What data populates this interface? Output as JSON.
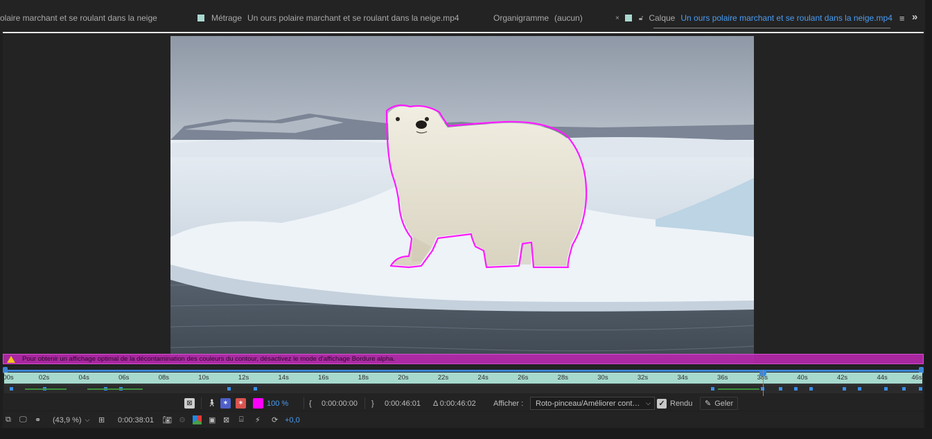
{
  "tabs": {
    "tab1_label": "olaire marchant et se roulant dans la neige",
    "tab2_prefix": "Métrage",
    "tab2_label": "Un ours polaire marchant et se roulant dans la neige.mp4",
    "tab3_prefix": "Organigramme",
    "tab3_label": "(aucun)",
    "tab4_close": "×",
    "tab4_prefix": "Calque",
    "tab4_label": "Un ours polaire marchant et se roulant dans la neige.mp4",
    "menu_icon": "≡",
    "overflow_icon": "»"
  },
  "warning": {
    "text": "Pour obtenir un affichage optimal de la décontamination des couleurs du contour, désactivez le mode d'affichage Bordure alpha."
  },
  "timeline": {
    "ticks": [
      "00s",
      "02s",
      "04s",
      "06s",
      "08s",
      "10s",
      "12s",
      "14s",
      "16s",
      "18s",
      "20s",
      "22s",
      "24s",
      "26s",
      "28s",
      "30s",
      "32s",
      "34s",
      "36s",
      "38s",
      "40s",
      "42s",
      "44s",
      "46s"
    ],
    "duration_s": 46.01,
    "playhead_s": 38.01
  },
  "roto_toolbar": {
    "opacity": "100 %",
    "in_time": "0:00:00:00",
    "out_time": "0:00:46:01",
    "duration": "Δ 0:00:46:02",
    "afficher_label": "Afficher :",
    "afficher_value": "Roto-pinceau/Améliorer cont…",
    "rendu_label": "Rendu",
    "geler_label": "Geler",
    "colors": {
      "outline": "#ff1aff",
      "pink_icon": "#ff00ff"
    }
  },
  "bottom_toolbar": {
    "zoom": "(43,9 %)",
    "timecode": "0:00:38:01",
    "exposure": "+0,0"
  }
}
